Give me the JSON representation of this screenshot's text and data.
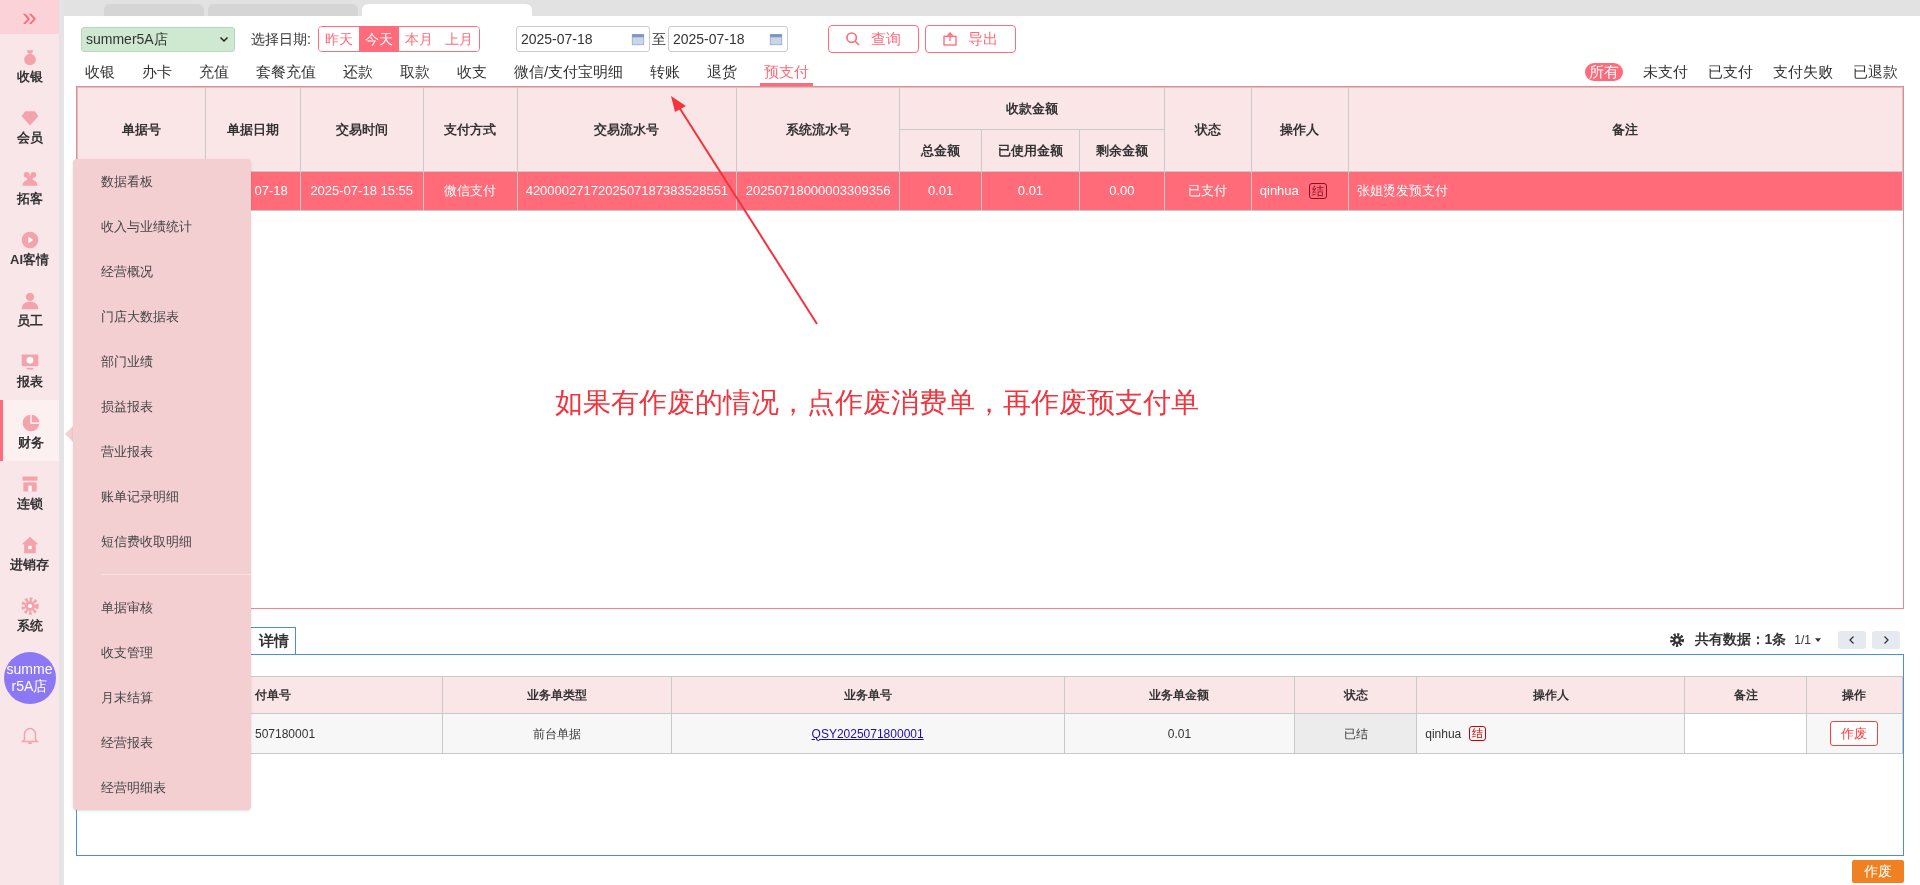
{
  "sidebar": {
    "toggle": "»",
    "items": [
      {
        "label": "收银",
        "selected": false
      },
      {
        "label": "会员",
        "selected": false
      },
      {
        "label": "拓客",
        "selected": false
      },
      {
        "label": "AI客情",
        "selected": false
      },
      {
        "label": "员工",
        "selected": false
      },
      {
        "label": "报表",
        "selected": false
      },
      {
        "label": "财务",
        "selected": true
      },
      {
        "label": "连锁",
        "selected": false
      },
      {
        "label": "进销存",
        "selected": false
      },
      {
        "label": "系统",
        "selected": false
      }
    ],
    "avatar": "summer5A店"
  },
  "browser_tabs": [
    {
      "selected": false
    },
    {
      "selected": false
    },
    {
      "selected": true
    }
  ],
  "toolbar": {
    "store": "summer5A店",
    "date_label": "选择日期:",
    "quick_ranges": [
      {
        "label": "昨天",
        "selected": false
      },
      {
        "label": "今天",
        "selected": true
      },
      {
        "label": "本月",
        "selected": false
      },
      {
        "label": "上月",
        "selected": false
      }
    ],
    "date_from": "2025-07-18",
    "date_sep": "至",
    "date_to": "2025-07-18",
    "search_button": "查询",
    "export_button": "导出"
  },
  "nav_tabs": [
    {
      "label": "收银",
      "selected": false
    },
    {
      "label": "办卡",
      "selected": false
    },
    {
      "label": "充值",
      "selected": false
    },
    {
      "label": "套餐充值",
      "selected": false
    },
    {
      "label": "还款",
      "selected": false
    },
    {
      "label": "取款",
      "selected": false
    },
    {
      "label": "收支",
      "selected": false
    },
    {
      "label": "微信/支付宝明细",
      "selected": false
    },
    {
      "label": "转账",
      "selected": false
    },
    {
      "label": "退货",
      "selected": false
    },
    {
      "label": "预支付",
      "selected": true
    }
  ],
  "status_filters": [
    {
      "label": "所有",
      "selected": true
    },
    {
      "label": "未支付",
      "selected": false
    },
    {
      "label": "已支付",
      "selected": false
    },
    {
      "label": "支付失败",
      "selected": false
    },
    {
      "label": "已退款",
      "selected": false
    }
  ],
  "table": {
    "columns": [
      {
        "label": "单据号"
      },
      {
        "label": "单据日期"
      },
      {
        "label": "交易时间"
      },
      {
        "label": "支付方式"
      },
      {
        "label": "交易流水号"
      },
      {
        "label": "系统流水号"
      },
      {
        "label": "收款金额",
        "colspan": 3,
        "children": [
          {
            "label": "总金额"
          },
          {
            "label": "已使用金额"
          },
          {
            "label": "剩余金额"
          }
        ]
      },
      {
        "label": "状态"
      },
      {
        "label": "操作人"
      },
      {
        "label": "备注"
      }
    ],
    "rows": [
      {
        "selected": true,
        "cells": [
          null,
          {
            "text": "07-18",
            "kind": "partial"
          },
          {
            "text": "2025-07-18 15:55"
          },
          {
            "text": "微信支付"
          },
          {
            "text": "4200002717202507187383528551"
          },
          {
            "text": "20250718000003309356"
          },
          {
            "text": "0.01"
          },
          {
            "text": "0.01"
          },
          {
            "text": "0.00"
          },
          {
            "text": "已支付"
          },
          {
            "text": "qinhua",
            "badge": "结"
          },
          {
            "text": "张姐烫发预支付",
            "kind": "left"
          }
        ]
      }
    ]
  },
  "annotation": "如果有作废的情况，点作废消费单，再作废预支付单",
  "flyout_menu": {
    "groups": [
      [
        "数据看板",
        "收入与业绩统计",
        "经营概况",
        "门店大数据表",
        "部门业绩",
        "损益报表",
        "营业报表",
        "账单记录明细",
        "短信费收取明细"
      ],
      [
        "单据审核",
        "收支管理",
        "月末结算",
        "经营报表",
        "经营明细表"
      ]
    ]
  },
  "detail": {
    "tab": "详情",
    "summary": "共有数据：**1**条",
    "pager": "1/1",
    "columns": [
      {
        "label": "付单号",
        "kind": "partial"
      },
      {
        "label": "业务单类型"
      },
      {
        "label": "业务单号"
      },
      {
        "label": "业务单金额"
      },
      {
        "label": "状态"
      },
      {
        "label": "操作人"
      },
      {
        "label": "备注"
      },
      {
        "label": "操作"
      }
    ],
    "rows": [
      {
        "cells": [
          {
            "text": "507180001",
            "kind": "partial"
          },
          {
            "text": "前台单据"
          },
          {
            "text": "QSY2025071800001",
            "kind": "link"
          },
          {
            "text": "0.01"
          },
          {
            "text": "已结",
            "kind": "shaded"
          },
          {
            "text": "qinhua",
            "badge": "结",
            "kind": "left"
          },
          null,
          {
            "text": "作废",
            "kind": "button"
          }
        ]
      }
    ]
  },
  "footer_button": "作废"
}
